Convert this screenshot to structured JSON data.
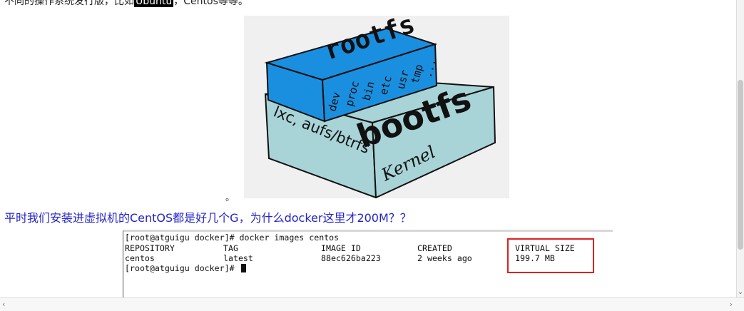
{
  "document": {
    "top_line_before": "不同的操作系统发行版，比如",
    "top_line_highlight": "Ubuntu",
    "top_line_after": "，Centos等等。",
    "bullet": "。",
    "question": "平时我们安装进虚拟机的CentOS都是好几个G，为什么docker这里才200M？？"
  },
  "diagram": {
    "rootfs_label": "rootfs",
    "bootfs_label": "bootfs",
    "kernel_label": "Kernel",
    "lxc_label": "lxc, aufs/btrfs",
    "dirs": [
      "dev",
      "proc",
      "bin",
      "etc",
      "usr",
      "tmp",
      "..."
    ],
    "colors": {
      "rootfs": "#1a8fe0",
      "bootfs": "#a8d4d8",
      "outline": "#111111"
    }
  },
  "terminal": {
    "command_line": "[root@atguigu docker]# docker images centos",
    "headers": [
      "REPOSITORY",
      "TAG",
      "IMAGE ID",
      "CREATED",
      "VIRTUAL SIZE"
    ],
    "row": [
      "centos",
      "latest",
      "88ec626ba223",
      "2 weeks ago",
      "199.7 MB"
    ],
    "prompt": "[root@atguigu docker]# "
  },
  "scrollbars": {
    "down_arrow": "⌄",
    "left_arrow": "‹",
    "right_arrow": "›"
  }
}
